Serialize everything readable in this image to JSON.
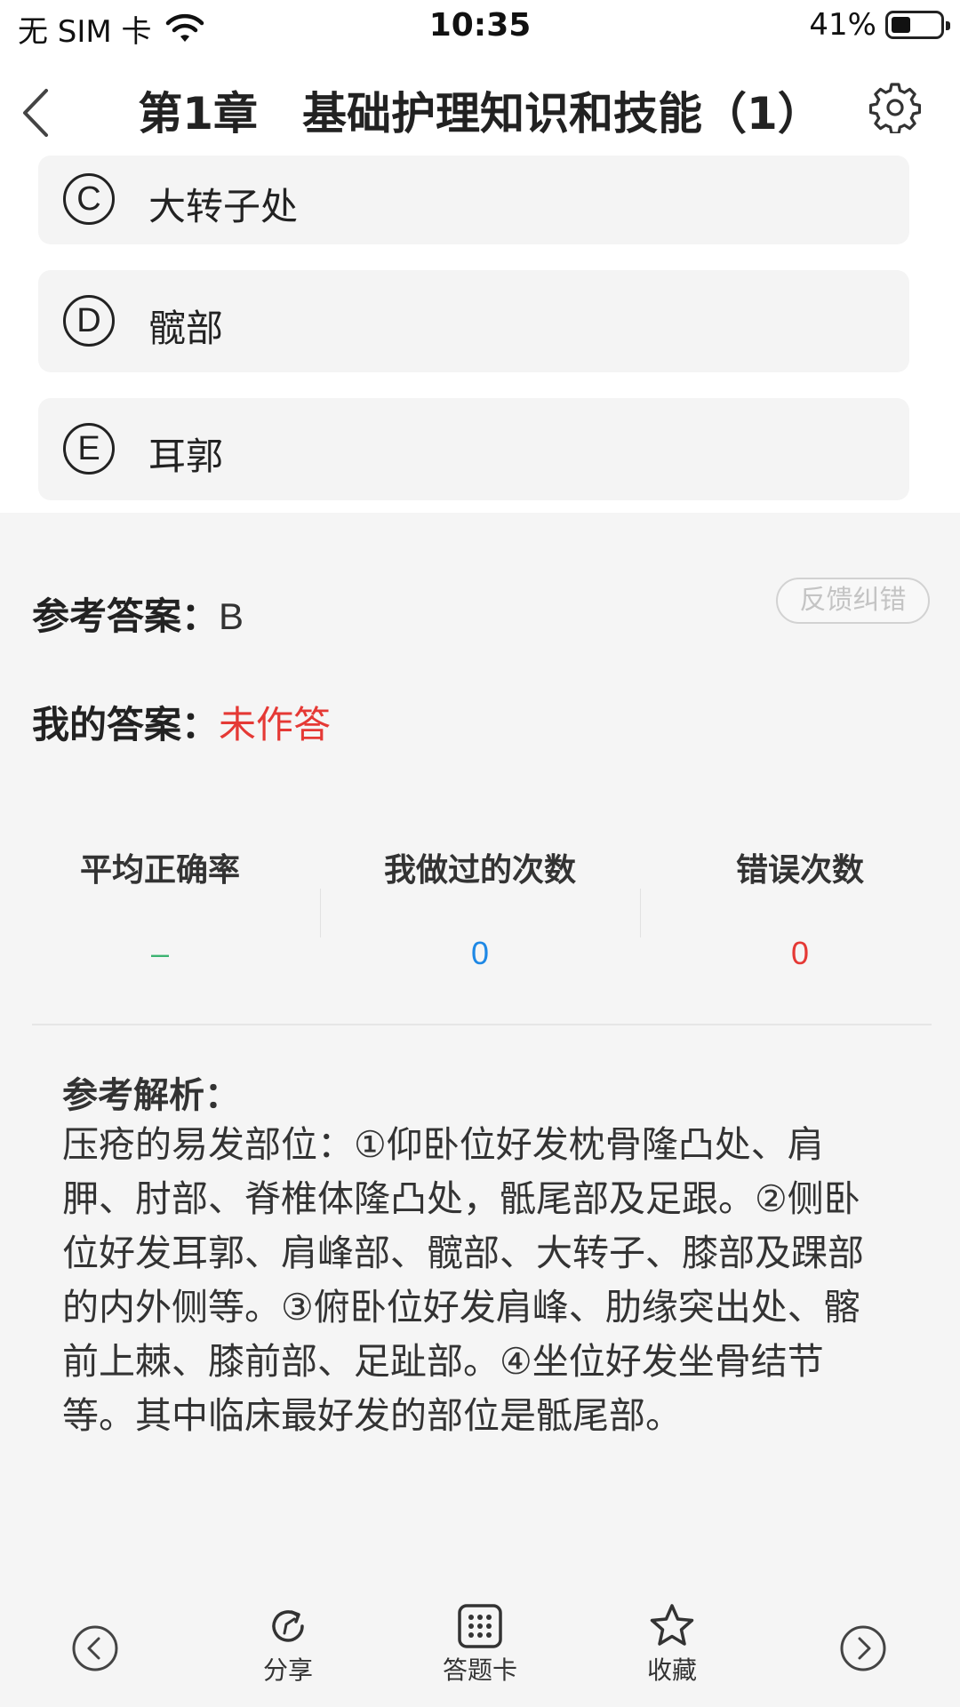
{
  "status_bar": {
    "carrier": "无 SIM 卡",
    "time": "10:35",
    "battery": "41%",
    "battery_level": 0.41
  },
  "nav": {
    "title": "第1章　基础护理知识和技能（1）",
    "back_icon": "chevron-left-icon",
    "settings_icon": "gear-icon"
  },
  "options": [
    {
      "letter": "C",
      "text": "大转子处"
    },
    {
      "letter": "D",
      "text": "髋部"
    },
    {
      "letter": "E",
      "text": "耳郭"
    }
  ],
  "answer": {
    "reference_label": "参考答案：",
    "reference_value": "B",
    "mine_label": "我的答案：",
    "mine_value": "未作答",
    "feedback_button": "反馈纠错"
  },
  "stats": [
    {
      "label": "平均正确率",
      "value": "–",
      "color": "#3cb371"
    },
    {
      "label": "我做过的次数",
      "value": "0",
      "color": "#1e88e5"
    },
    {
      "label": "错误次数",
      "value": "0",
      "color": "#e53935"
    }
  ],
  "analysis": {
    "title": "参考解析：",
    "body": "压疮的易发部位：①仰卧位好发枕骨隆凸处、肩胛、肘部、脊椎体隆凸处，骶尾部及足跟。②侧卧位好发耳郭、肩峰部、髋部、大转子、膝部及踝部的内外侧等。③俯卧位好发肩峰、肋缘突出处、髂前上棘、膝前部、足趾部。④坐位好发坐骨结节等。其中临床最好发的部位是骶尾部。"
  },
  "tabbar": {
    "share_label": "分享",
    "card_label": "答题卡",
    "favorite_label": "收藏",
    "prev_icon": "prev-circle-icon",
    "next_icon": "next-circle-icon"
  }
}
